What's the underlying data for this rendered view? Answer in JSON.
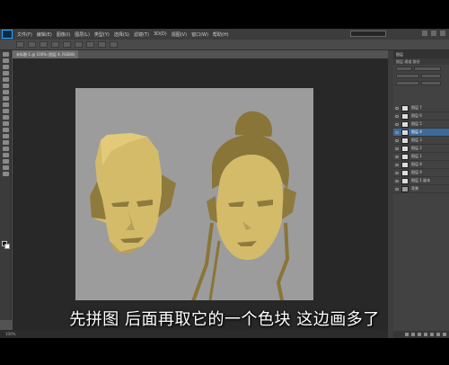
{
  "menubar": {
    "items": [
      "文件(F)",
      "编辑(E)",
      "图像(I)",
      "图层(L)",
      "类型(Y)",
      "选择(S)",
      "滤镜(T)",
      "3D(D)",
      "视图(V)",
      "窗口(W)",
      "帮助(H)"
    ]
  },
  "document": {
    "tab_label": "未标题-1 @ 100% (图层 4, RGB/8)"
  },
  "status": {
    "zoom": "100%"
  },
  "panel": {
    "title": "图层",
    "tabs": "图层  通道  路径"
  },
  "layers": [
    {
      "name": "图层 7",
      "active": false
    },
    {
      "name": "图层 6",
      "active": false
    },
    {
      "name": "图层 5",
      "active": false
    },
    {
      "name": "图层 4",
      "active": true
    },
    {
      "name": "图层 3",
      "active": false
    },
    {
      "name": "图层 2",
      "active": false
    },
    {
      "name": "图层 1",
      "active": false
    },
    {
      "name": "图层 8",
      "active": false
    },
    {
      "name": "图层 9",
      "active": false
    },
    {
      "name": "图层 1 副本",
      "active": false
    },
    {
      "name": "背景",
      "active": false
    }
  ],
  "subtitle": "先拼图  后面再取它的一个色块  这边画多了",
  "colors": {
    "canvas_bg": "#9c9c9c",
    "skin": "#d4bb6a",
    "shadow": "#8e7a3c",
    "hair": "#8a7538"
  }
}
